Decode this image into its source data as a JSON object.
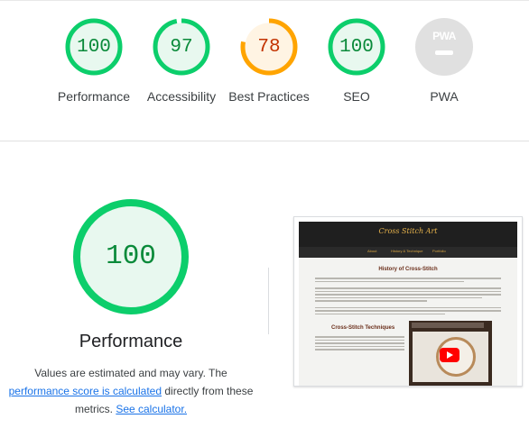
{
  "colors": {
    "pass": "#0cce6b",
    "pass_bg": "#e8f8ef",
    "pass_text": "#0a8a3a",
    "average": "#ffa400",
    "average_bg": "#fff4e3",
    "average_text": "#c33300",
    "na": "#e0e0e0",
    "link": "#1a73e8"
  },
  "categories": [
    {
      "label": "Performance",
      "score": 100,
      "status": "pass"
    },
    {
      "label": "Accessibility",
      "score": 97,
      "status": "pass"
    },
    {
      "label": "Best Practices",
      "score": 78,
      "status": "average"
    },
    {
      "label": "SEO",
      "score": 100,
      "status": "pass"
    },
    {
      "label": "PWA",
      "score": null,
      "status": "na",
      "icon_text": "PWA",
      "icon": "pwa-icon"
    }
  ],
  "performance_section": {
    "score": 100,
    "title": "Performance",
    "desc_prefix": "Values are estimated and may vary. The ",
    "link_calc_score": "performance score is calculated",
    "desc_middle": " directly from these metrics. ",
    "link_calculator": "See calculator."
  },
  "screenshot": {
    "site_title": "Cross Stitch Art",
    "nav": [
      "About",
      "History & Technique",
      "Portfolio"
    ],
    "heading_1": "History of Cross-Stitch",
    "heading_2": "Cross-Stitch Techniques",
    "video_icon": "youtube-play-icon"
  }
}
